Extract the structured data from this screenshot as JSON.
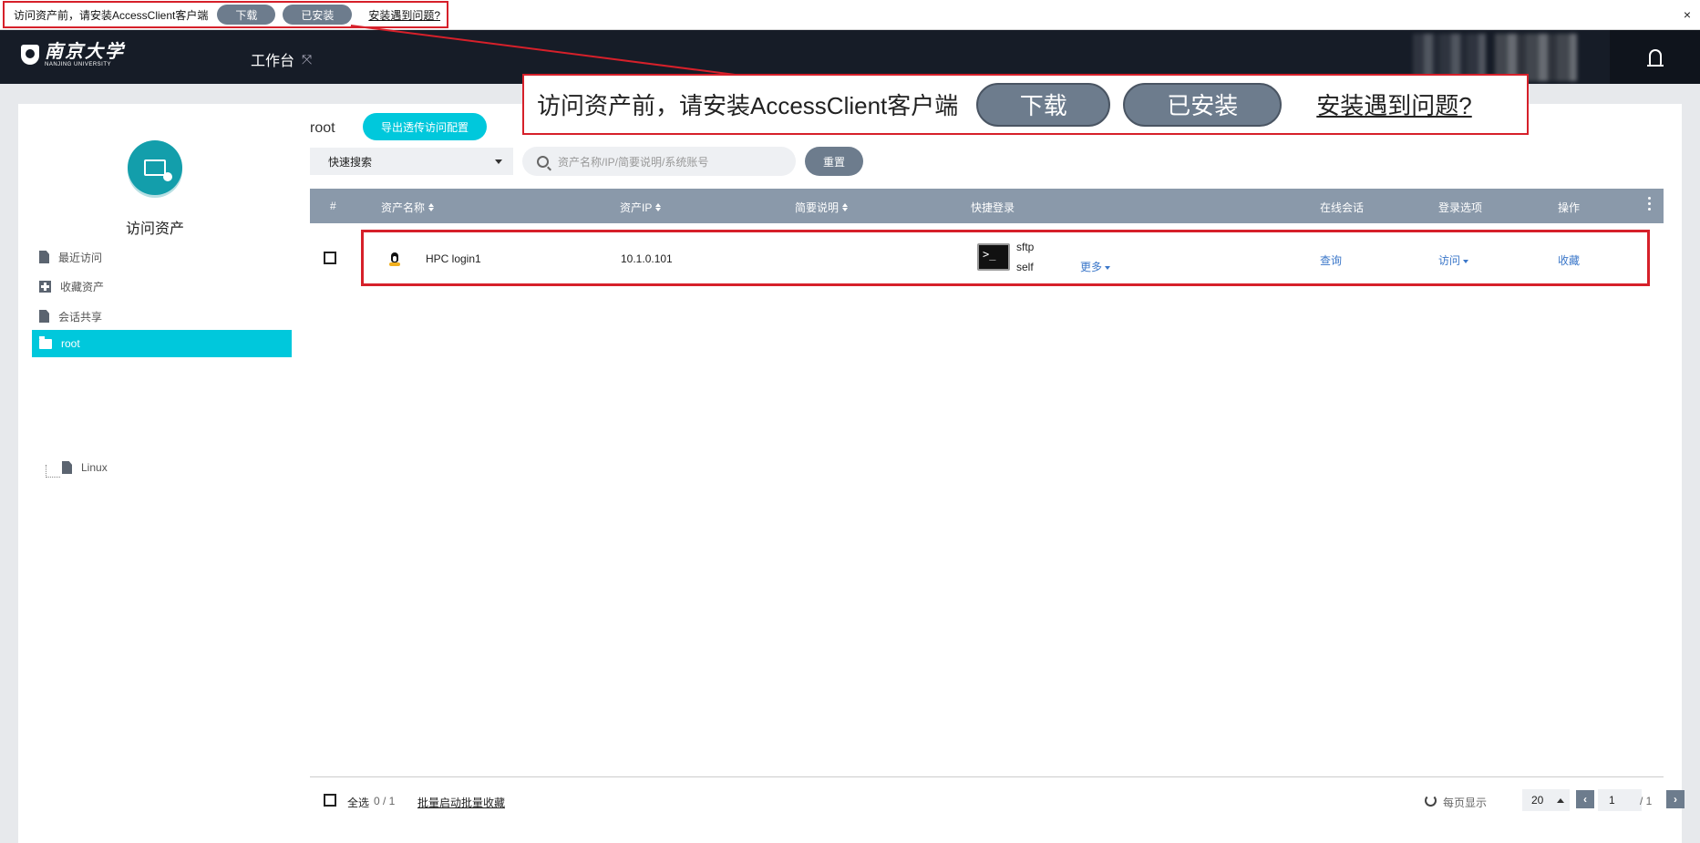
{
  "notice": {
    "text": "访问资产前，请安装AccessClient客户端",
    "download_label": "下载",
    "installed_label": "已安装",
    "problem_link": "安装遇到问题?",
    "close_glyph": "×"
  },
  "header": {
    "logo_cn": "南京大学",
    "logo_en": "NANJING UNIVERSITY",
    "workbench_label": "工作台",
    "workbench_icon": "⤧"
  },
  "sidebar": {
    "title": "访问资产",
    "items": [
      {
        "label": "最近访问",
        "icon": "document-icon"
      },
      {
        "label": "收藏资产",
        "icon": "plus-square-icon"
      },
      {
        "label": "会话共享",
        "icon": "document-icon"
      },
      {
        "label": "root",
        "icon": "folder-icon",
        "active": true
      }
    ],
    "sub_item": {
      "label": "Linux",
      "icon": "document-icon"
    }
  },
  "main": {
    "breadcrumb": "root",
    "export_button": "导出透传访问配置",
    "search_mode": "快速搜索",
    "search_placeholder": "资产名称/IP/简要说明/系统账号",
    "reset_button": "重置",
    "columns": {
      "index": "#",
      "name": "资产名称",
      "ip": "资产IP",
      "desc": "简要说明",
      "quick_login": "快捷登录",
      "online_session": "在线会话",
      "login_option": "登录选项",
      "action": "操作"
    },
    "rows": [
      {
        "name": "HPC login1",
        "os_icon": "linux-tux-icon",
        "ip": "10.1.0.101",
        "desc": "",
        "terminal_glyph": ">_",
        "protocol": "sftp",
        "account": "self",
        "more": "更多",
        "online_session": "查询",
        "login_option": "访问",
        "action": "收藏"
      }
    ]
  },
  "footer": {
    "select_all": "全选",
    "count": "0 / 1",
    "batch_start": "批量启动",
    "batch_favorite": "批量收藏",
    "per_page_label": "每页显示",
    "per_page": "20",
    "current_page": "1",
    "total_pages": "/ 1",
    "prev_glyph": "‹",
    "next_glyph": "›"
  },
  "colors": {
    "accent": "#00c8dc",
    "header_bg": "#161c27",
    "pill_gray": "#6d7c8d",
    "table_header": "#8a99aa",
    "highlight_red": "#d6202a",
    "link_blue": "#3b77c9"
  }
}
